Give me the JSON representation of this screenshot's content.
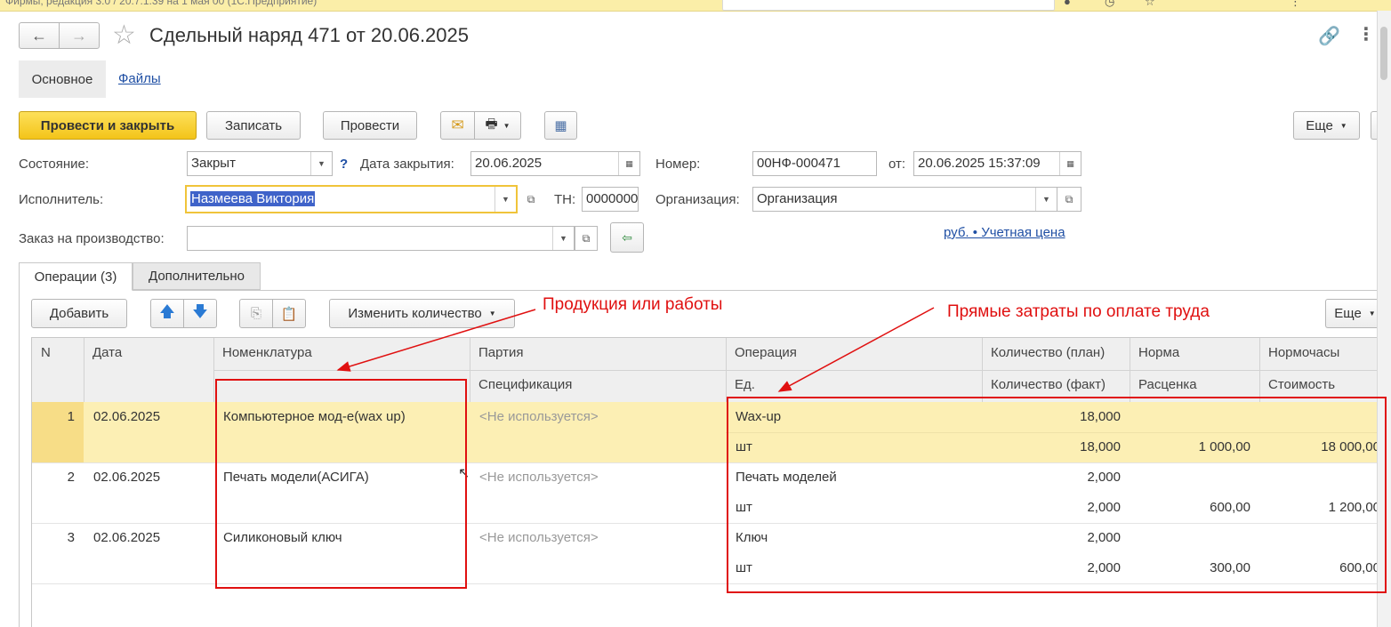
{
  "window": {
    "top_text": "Фирмы, редакция 3.0 / 20.7.1.39 на 1 мая 00 (1С:Предприятие)"
  },
  "title": "Сдельный наряд 471 от 20.06.2025",
  "nav": {
    "back": "←",
    "forward": "→",
    "star": "☆"
  },
  "panel_tabs": [
    {
      "label": "Основное"
    },
    {
      "label": "Файлы"
    }
  ],
  "toolbar": {
    "post_close": "Провести и закрыть",
    "save": "Записать",
    "post": "Провести",
    "more": "Еще"
  },
  "form": {
    "state_label": "Состояние:",
    "state_value": "Закрыт",
    "help": "?",
    "close_date_label": "Дата закрытия:",
    "close_date_value": "20.06.2025",
    "number_label": "Номер:",
    "number_value": "00НФ-000471",
    "from_label": "от:",
    "from_value": "20.06.2025 15:37:09",
    "executor_label": "Исполнитель:",
    "executor_value": "Назмеева Виктория",
    "tn_label": "ТН:",
    "tn_value": "0000000",
    "org_label": "Организация:",
    "org_value": "Организация",
    "order_label": "Заказ на производство:",
    "order_value": "",
    "price_link": "руб. • Учетная цена"
  },
  "sub_tabs": [
    {
      "label": "Операции (3)"
    },
    {
      "label": "Дополнительно"
    }
  ],
  "table_toolbar": {
    "add": "Добавить",
    "change_qty": "Изменить количество",
    "more": "Еще"
  },
  "table": {
    "headers_top": [
      "N",
      "Дата",
      "Номенклатура",
      "Партия",
      "Операция",
      "Количество (план)",
      "Норма",
      "Нормочасы"
    ],
    "headers_bottom": [
      "Спецификация",
      "Ед.",
      "Количество (факт)",
      "Расценка",
      "Стоимость"
    ],
    "rows": [
      {
        "n": "1",
        "date": "02.06.2025",
        "item": "Компьютерное мод-е(wax up)",
        "batch": "<Не используется>",
        "operation": "Wax-up",
        "unit": "шт",
        "qty_plan": "18,000",
        "qty_fact": "18,000",
        "norm": "",
        "rate": "1 000,00",
        "norm_hours": "",
        "cost": "18 000,00"
      },
      {
        "n": "2",
        "date": "02.06.2025",
        "item": "Печать модели(АСИГА)",
        "batch": "<Не используется>",
        "operation": "Печать моделей",
        "unit": "шт",
        "qty_plan": "2,000",
        "qty_fact": "2,000",
        "norm": "",
        "rate": "600,00",
        "norm_hours": "",
        "cost": "1 200,00"
      },
      {
        "n": "3",
        "date": "02.06.2025",
        "item": "Силиконовый ключ",
        "batch": "<Не используется>",
        "operation": "Ключ",
        "unit": "шт",
        "qty_plan": "2,000",
        "qty_fact": "2,000",
        "norm": "",
        "rate": "300,00",
        "norm_hours": "",
        "cost": "600,00"
      }
    ]
  },
  "annotations": {
    "products": "Продукция или работы",
    "labor": "Прямые затраты по оплате труда"
  },
  "colors": {
    "accent_yellow": "#f5c518",
    "selected_row": "#fcefb4",
    "annotation_red": "#e01010",
    "link_blue": "#1f4fa4"
  }
}
